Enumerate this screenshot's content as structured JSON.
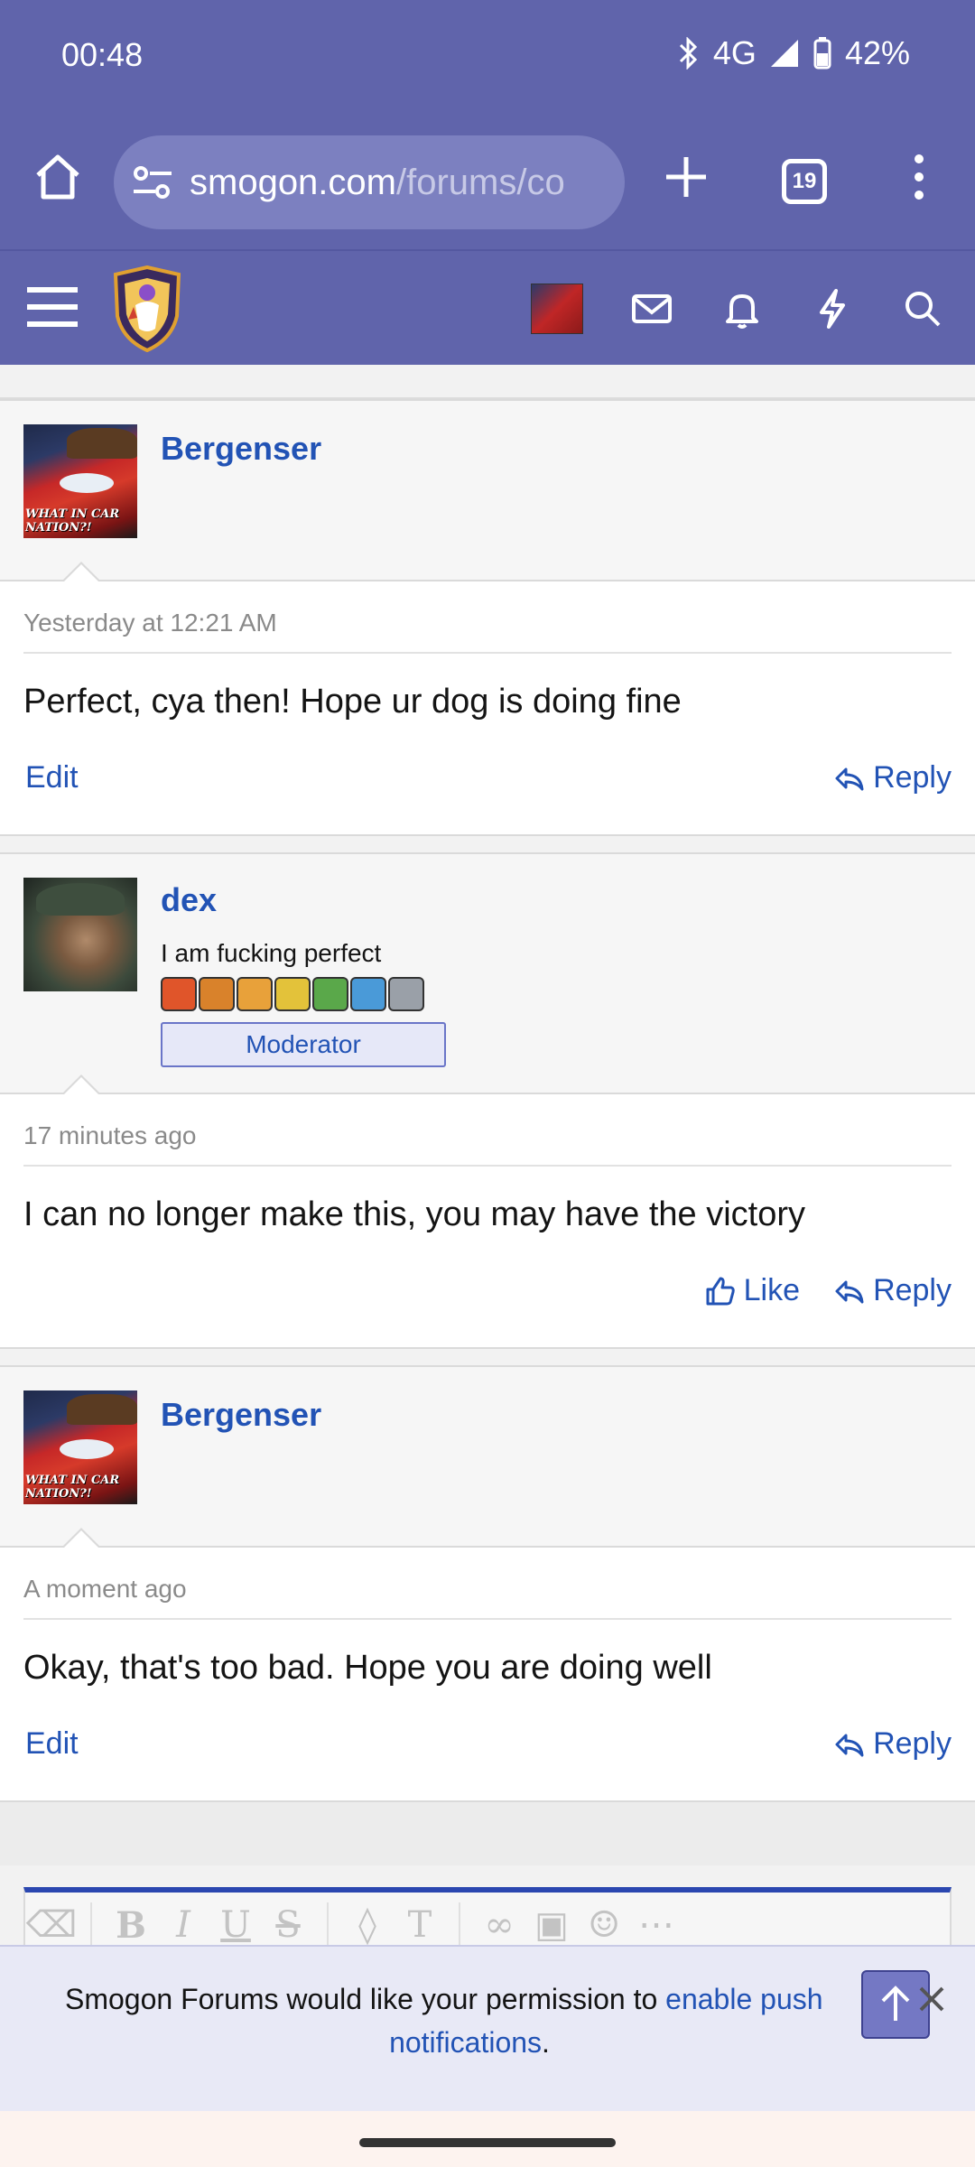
{
  "status_bar": {
    "time": "00:48",
    "network": "4G",
    "battery": "42%"
  },
  "browser": {
    "url_host": "smogon.com",
    "url_path": "/forums/co",
    "tab_count": "19"
  },
  "posts": [
    {
      "username": "Bergenser",
      "date": "Yesterday at 12:21 AM",
      "text": "Perfect, cya then! Hope ur dog is doing fine",
      "actions": {
        "edit": "Edit",
        "reply": "Reply"
      },
      "avatar_caption": "WHAT IN CAR NATION?!"
    },
    {
      "username": "dex",
      "user_title": "I am fucking perfect",
      "role_banner": "Moderator",
      "date": "17 minutes ago",
      "text": "I can no longer make this, you may have the victory",
      "actions": {
        "like": "Like",
        "reply": "Reply"
      }
    },
    {
      "username": "Bergenser",
      "date": "A moment ago",
      "text": "Okay, that's too bad. Hope you are doing well",
      "actions": {
        "edit": "Edit",
        "reply": "Reply"
      },
      "avatar_caption": "WHAT IN CAR NATION?!"
    }
  ],
  "badge_colors": [
    "#e0552a",
    "#d9822b",
    "#e8a13a",
    "#e3c23a",
    "#5aa84a",
    "#4a9ad8",
    "#9aa0a8"
  ],
  "notification": {
    "text": "Smogon Forums would like your permission to ",
    "link1": "enable push",
    "link2": "notifications",
    "end": "."
  },
  "colors": {
    "brand": "#6064ab",
    "link": "#2253b5"
  }
}
